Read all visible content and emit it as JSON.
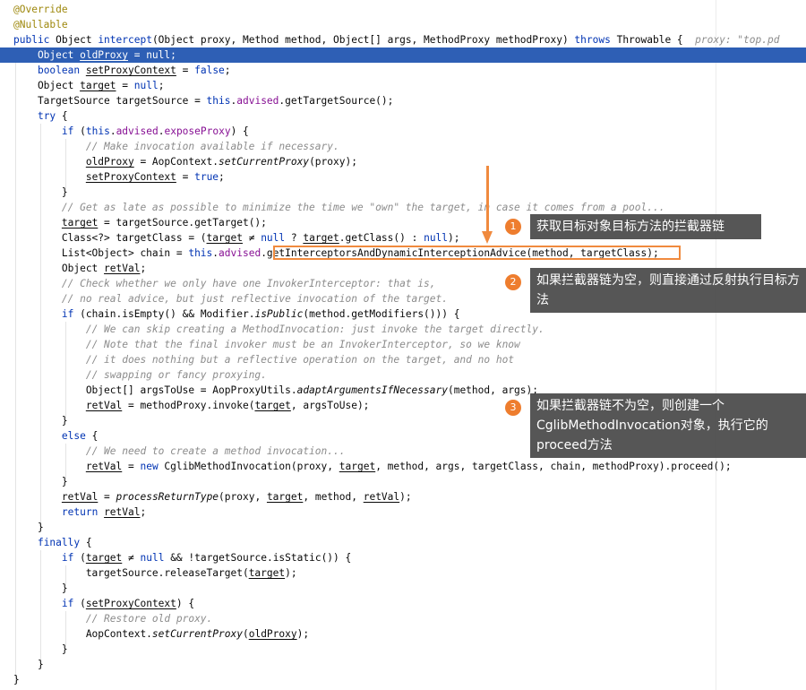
{
  "code_lines": [
    [
      {
        "t": "@Override",
        "c": "ann"
      }
    ],
    [
      {
        "t": "@Nullable",
        "c": "ann"
      }
    ],
    [
      {
        "t": "public ",
        "c": "kw"
      },
      {
        "t": "Object "
      },
      {
        "t": "intercept",
        "c": "kw"
      },
      {
        "t": "(Object proxy, Method method, Object[] args, MethodProxy methodProxy) "
      },
      {
        "t": "throws ",
        "c": "kw"
      },
      {
        "t": "Throwable { "
      },
      {
        "t": " proxy: \"top.pd",
        "c": "hint"
      }
    ],
    [
      {
        "t": "    Object "
      },
      {
        "t": "oldProxy",
        "c": "ul"
      },
      {
        "t": " = null;"
      }
    ],
    [
      {
        "t": "    "
      },
      {
        "t": "boolean ",
        "c": "kw"
      },
      {
        "t": "setProxyContext",
        "c": "ul"
      },
      {
        "t": " = "
      },
      {
        "t": "false",
        "c": "kw"
      },
      {
        "t": ";"
      }
    ],
    [
      {
        "t": "    Object "
      },
      {
        "t": "target",
        "c": "ul"
      },
      {
        "t": " = "
      },
      {
        "t": "null",
        "c": "kw"
      },
      {
        "t": ";"
      }
    ],
    [
      {
        "t": "    TargetSource targetSource = "
      },
      {
        "t": "this",
        "c": "kw"
      },
      {
        "t": "."
      },
      {
        "t": "advised",
        "c": "fld"
      },
      {
        "t": ".getTargetSource();"
      }
    ],
    [
      {
        "t": "    "
      },
      {
        "t": "try",
        "c": "kw"
      },
      {
        "t": " {"
      }
    ],
    [
      {
        "t": "        "
      },
      {
        "t": "if",
        "c": "kw"
      },
      {
        "t": " ("
      },
      {
        "t": "this",
        "c": "kw"
      },
      {
        "t": "."
      },
      {
        "t": "advised",
        "c": "fld"
      },
      {
        "t": "."
      },
      {
        "t": "exposeProxy",
        "c": "fld"
      },
      {
        "t": ") {"
      }
    ],
    [
      {
        "t": "            "
      },
      {
        "t": "// Make invocation available if necessary.",
        "c": "cm"
      }
    ],
    [
      {
        "t": "            "
      },
      {
        "t": "oldProxy",
        "c": "ul"
      },
      {
        "t": " = AopContext."
      },
      {
        "t": "setCurrentProxy",
        "c": "mi"
      },
      {
        "t": "(proxy);"
      }
    ],
    [
      {
        "t": "            "
      },
      {
        "t": "setProxyContext",
        "c": "ul"
      },
      {
        "t": " = "
      },
      {
        "t": "true",
        "c": "kw"
      },
      {
        "t": ";"
      }
    ],
    [
      {
        "t": "        }"
      }
    ],
    [
      {
        "t": "        "
      },
      {
        "t": "// Get as late as possible to minimize the time we \"own\" the target, in case it comes from a pool...",
        "c": "cm"
      }
    ],
    [
      {
        "t": "        "
      },
      {
        "t": "target",
        "c": "ul"
      },
      {
        "t": " = targetSource.getTarget();"
      }
    ],
    [
      {
        "t": "        Class<?> targetClass = ("
      },
      {
        "t": "target",
        "c": "ul"
      },
      {
        "t": " ≠ "
      },
      {
        "t": "null",
        "c": "kw"
      },
      {
        "t": " ? "
      },
      {
        "t": "target",
        "c": "ul"
      },
      {
        "t": ".getClass() : "
      },
      {
        "t": "null",
        "c": "kw"
      },
      {
        "t": ");"
      }
    ],
    [
      {
        "t": "        List<Object> chain = "
      },
      {
        "t": "this",
        "c": "kw"
      },
      {
        "t": "."
      },
      {
        "t": "advised",
        "c": "fld"
      },
      {
        "t": ".getInterceptorsAndDynamicInterceptionAdvice(method, targetClass);"
      }
    ],
    [
      {
        "t": "        Object "
      },
      {
        "t": "retVal",
        "c": "ul"
      },
      {
        "t": ";"
      }
    ],
    [
      {
        "t": "        "
      },
      {
        "t": "// Check whether we only have one InvokerInterceptor: that is,",
        "c": "cm"
      }
    ],
    [
      {
        "t": "        "
      },
      {
        "t": "// no real advice, but just reflective invocation of the target.",
        "c": "cm"
      }
    ],
    [
      {
        "t": "        "
      },
      {
        "t": "if",
        "c": "kw"
      },
      {
        "t": " (chain.isEmpty() && Modifier."
      },
      {
        "t": "isPublic",
        "c": "mi"
      },
      {
        "t": "(method.getModifiers())) {"
      }
    ],
    [
      {
        "t": "            "
      },
      {
        "t": "// We can skip creating a MethodInvocation: just invoke the target directly.",
        "c": "cm"
      }
    ],
    [
      {
        "t": "            "
      },
      {
        "t": "// Note that the final invoker must be an InvokerInterceptor, so we know",
        "c": "cm"
      }
    ],
    [
      {
        "t": "            "
      },
      {
        "t": "// it does nothing but a reflective operation on the target, and no hot",
        "c": "cm"
      }
    ],
    [
      {
        "t": "            "
      },
      {
        "t": "// swapping or fancy proxying.",
        "c": "cm"
      }
    ],
    [
      {
        "t": "            Object[] argsToUse = AopProxyUtils."
      },
      {
        "t": "adaptArgumentsIfNecessary",
        "c": "mi"
      },
      {
        "t": "(method, args);"
      }
    ],
    [
      {
        "t": "            "
      },
      {
        "t": "retVal",
        "c": "ul"
      },
      {
        "t": " = methodProxy.invoke("
      },
      {
        "t": "target",
        "c": "ul"
      },
      {
        "t": ", argsToUse);"
      }
    ],
    [
      {
        "t": "        }"
      }
    ],
    [
      {
        "t": "        "
      },
      {
        "t": "else",
        "c": "kw"
      },
      {
        "t": " {"
      }
    ],
    [
      {
        "t": "            "
      },
      {
        "t": "// We need to create a method invocation...",
        "c": "cm"
      }
    ],
    [
      {
        "t": "            "
      },
      {
        "t": "retVal",
        "c": "ul"
      },
      {
        "t": " = "
      },
      {
        "t": "new",
        "c": "kw"
      },
      {
        "t": " CglibMethodInvocation(proxy, "
      },
      {
        "t": "target",
        "c": "ul"
      },
      {
        "t": ", method, args, targetClass, chain, methodProxy).proceed();"
      }
    ],
    [
      {
        "t": "        }"
      }
    ],
    [
      {
        "t": "        "
      },
      {
        "t": "retVal",
        "c": "ul"
      },
      {
        "t": " = "
      },
      {
        "t": "processReturnType",
        "c": "mi"
      },
      {
        "t": "(proxy, "
      },
      {
        "t": "target",
        "c": "ul"
      },
      {
        "t": ", method, "
      },
      {
        "t": "retVal",
        "c": "ul"
      },
      {
        "t": ");"
      }
    ],
    [
      {
        "t": "        "
      },
      {
        "t": "return",
        "c": "kw"
      },
      {
        "t": " "
      },
      {
        "t": "retVal",
        "c": "ul"
      },
      {
        "t": ";"
      }
    ],
    [
      {
        "t": "    }"
      }
    ],
    [
      {
        "t": "    "
      },
      {
        "t": "finally",
        "c": "kw"
      },
      {
        "t": " {"
      }
    ],
    [
      {
        "t": "        "
      },
      {
        "t": "if",
        "c": "kw"
      },
      {
        "t": " ("
      },
      {
        "t": "target",
        "c": "ul"
      },
      {
        "t": " ≠ "
      },
      {
        "t": "null",
        "c": "kw"
      },
      {
        "t": " && !targetSource.isStatic()) {"
      }
    ],
    [
      {
        "t": "            targetSource.releaseTarget("
      },
      {
        "t": "target",
        "c": "ul"
      },
      {
        "t": ");"
      }
    ],
    [
      {
        "t": "        }"
      }
    ],
    [
      {
        "t": "        "
      },
      {
        "t": "if",
        "c": "kw"
      },
      {
        "t": " ("
      },
      {
        "t": "setProxyContext",
        "c": "ul"
      },
      {
        "t": ") {"
      }
    ],
    [
      {
        "t": "            "
      },
      {
        "t": "// Restore old proxy.",
        "c": "cm"
      }
    ],
    [
      {
        "t": "            AopContext."
      },
      {
        "t": "setCurrentProxy",
        "c": "mi"
      },
      {
        "t": "("
      },
      {
        "t": "oldProxy",
        "c": "ul"
      },
      {
        "t": ");"
      }
    ],
    [
      {
        "t": "        }"
      }
    ],
    [
      {
        "t": "    }"
      }
    ],
    [
      {
        "t": "}"
      }
    ]
  ],
  "highlighted_line": 4,
  "highlight_color": "#2e5fb5",
  "accent_color": "#f08a3e",
  "callouts": [
    {
      "number": "1",
      "text": "获取目标对象目标方法的拦截器链"
    },
    {
      "number": "2",
      "text": "如果拦截器链为空，则直接通过反射执行目标方法"
    },
    {
      "number": "3",
      "text": "如果拦截器链不为空，则创建一个CglibMethodInvocation对象，执行它的proceed方法"
    }
  ]
}
